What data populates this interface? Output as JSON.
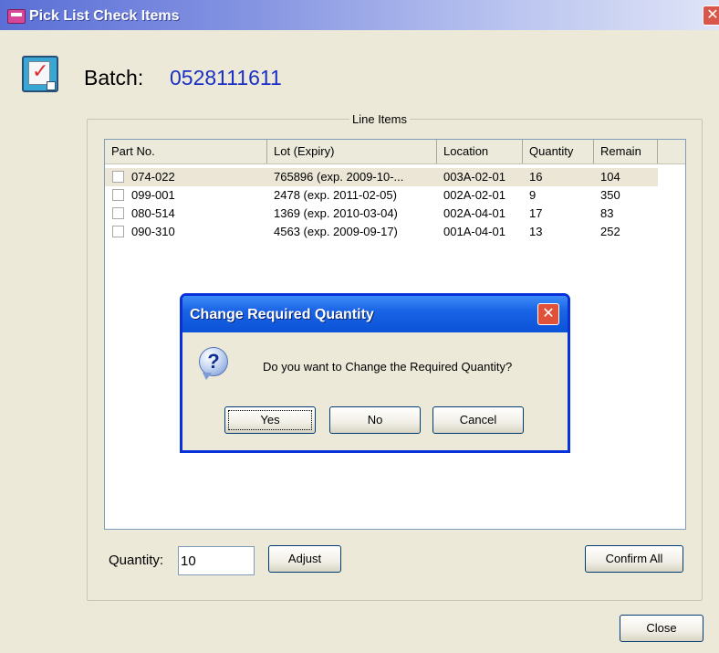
{
  "window": {
    "title": "Pick List Check Items",
    "close_glyph": "✕"
  },
  "batch": {
    "label": "Batch:",
    "value": "0528111611"
  },
  "line_items": {
    "legend": "Line Items",
    "columns": [
      "Part No.",
      "Lot (Expiry)",
      "Location",
      "Quantity",
      "Remain"
    ],
    "rows": [
      {
        "part": "074-022",
        "lot": "765896 (exp. 2009-10-...",
        "location": "003A-02-01",
        "quantity": "16",
        "remain": "104"
      },
      {
        "part": "099-001",
        "lot": "2478 (exp. 2011-02-05)",
        "location": "002A-02-01",
        "quantity": "9",
        "remain": "350"
      },
      {
        "part": "080-514",
        "lot": "1369 (exp. 2010-03-04)",
        "location": "002A-04-01",
        "quantity": "17",
        "remain": "83"
      },
      {
        "part": "090-310",
        "lot": "4563 (exp. 2009-09-17)",
        "location": "001A-04-01",
        "quantity": "13",
        "remain": "252"
      }
    ]
  },
  "dialog": {
    "title": "Change Required Quantity",
    "message": "Do you want to Change the Required Quantity?",
    "icon": "question-icon",
    "close_glyph": "✕",
    "buttons": {
      "yes": "Yes",
      "no": "No",
      "cancel": "Cancel"
    }
  },
  "footer": {
    "quantity_label": "Quantity:",
    "quantity_value": "10",
    "adjust": "Adjust",
    "confirm_all": "Confirm All",
    "close": "Close"
  },
  "colors": {
    "batch_value": "#1a2fc5",
    "dialog_title_bar": "#0a52d6",
    "window_face": "#ece9d8"
  }
}
